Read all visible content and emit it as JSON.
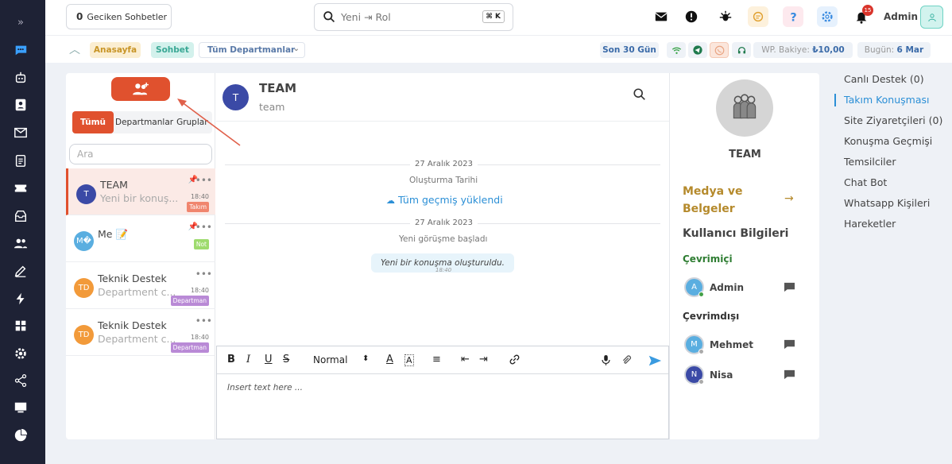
{
  "topbar": {
    "late_count": "0",
    "late_label": "Geciken Sohbetler",
    "search_placeholder": "Yeni ⇥ Rol",
    "search_shortcut": "⌘ K",
    "notification_count": "15",
    "admin_name": "Admin",
    "icons": [
      "envelope-icon",
      "alert-icon",
      "bug-icon",
      "chat-bubble-icon",
      "help-icon",
      "settings-icon",
      "bell-icon",
      "user-icon"
    ]
  },
  "subbar": {
    "home": "Anasayfa",
    "chat": "Sohbet",
    "departments": "Tüm Departmanlar",
    "period": "Son 30 Gün",
    "balance_label": "WP. Bakiye:",
    "balance_value": "₺10,00",
    "today_label": "Bugün:",
    "today_value": "6 Mar"
  },
  "left_panel": {
    "tabs": [
      "Tümü",
      "Departmanlar",
      "Gruplar"
    ],
    "search_placeholder": "Ara",
    "conversations": [
      {
        "initials": "T",
        "name": "TEAM",
        "preview": "Yeni bir konuş...",
        "time": "18:40",
        "badge": "Takım",
        "badge_color": "#f0856e",
        "avatar_color": "#3b4aa6"
      },
      {
        "initials": "M�",
        "name": "Me 📝",
        "preview": "",
        "time": "",
        "badge": "Not",
        "badge_color": "#9edb6e",
        "avatar_color": "#5aaee0"
      },
      {
        "initials": "TD",
        "name": "Teknik Destek",
        "preview": "Department c...",
        "time": "18:40",
        "badge": "Departman",
        "badge_color": "#b98ad6",
        "avatar_color": "#f29a3a"
      },
      {
        "initials": "TD",
        "name": "Teknik Destek",
        "preview": "Department c...",
        "time": "18:40",
        "badge": "Departman",
        "badge_color": "#b98ad6",
        "avatar_color": "#f29a3a"
      }
    ]
  },
  "chat": {
    "avatar_initial": "T",
    "title": "TEAM",
    "subtitle": "team",
    "date1": "27 Aralık 2023",
    "created_label": "Oluşturma Tarihi",
    "history_loaded": "Tüm geçmiş yüklendi",
    "date2": "27 Aralık 2023",
    "new_chat_started": "Yeni görüşme başladı",
    "message": "Yeni bir konuşma oluşturuldu.",
    "message_time": "18:40"
  },
  "composer": {
    "format_select": "Normal",
    "placeholder": "Insert text here ..."
  },
  "right_panel": {
    "title": "TEAM",
    "media_link": "Medya ve Belgeler",
    "user_info": "Kullanıcı Bilgileri",
    "online_label": "Çevrimiçi",
    "offline_label": "Çevrimdışı",
    "online_users": [
      {
        "initial": "A",
        "name": "Admin",
        "color": "#5aaee0"
      }
    ],
    "offline_users": [
      {
        "initial": "M",
        "name": "Mehmet",
        "color": "#5aaee0"
      },
      {
        "initial": "N",
        "name": "Nisa",
        "color": "#3b4aa6"
      }
    ]
  },
  "far_right_menu": [
    "Canlı Destek (0)",
    "Takım Konuşması",
    "Site Ziyaretçileri (0)",
    "Konuşma Geçmişi",
    "Temsilciler",
    "Chat Bot",
    "Whatsapp Kişileri",
    "Hareketler"
  ],
  "colors": {
    "accent": "#e0512e",
    "sidebar": "#1e2235",
    "link": "#2b8fd6",
    "gold": "#b58a2c"
  }
}
